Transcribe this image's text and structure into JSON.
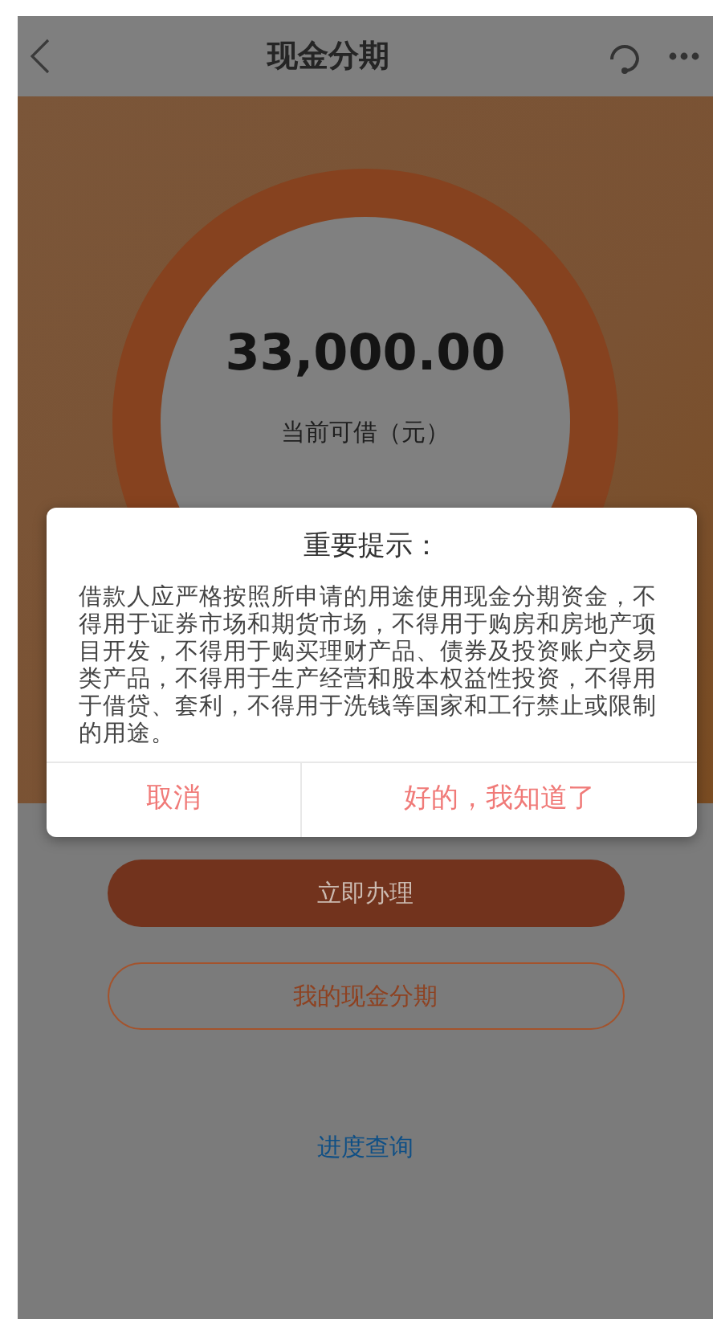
{
  "header": {
    "title": "现金分期"
  },
  "hero": {
    "amount": "33,000.00",
    "amount_label": "当前可借（元）"
  },
  "actions": [
    {
      "label": "立即办理",
      "kind": "primary"
    },
    {
      "label": "我的现金分期",
      "kind": "outline"
    }
  ],
  "progress_link": "进度查询",
  "dialog": {
    "title": "重要提示：",
    "message": "借款人应严格按照所申请的用途使用现金分期资金，不得用于证券市场和期货市场，不得用于购房和房地产项目开发，不得用于购买理财产品、债券及投资账户交易类产品，不得用于生产经营和股本权益性投资，不得用于借贷、套利，不得用于洗钱等国家和工行禁止或限制的用途。",
    "buttons": [
      {
        "label": "取消"
      },
      {
        "label": "好的，我知道了"
      }
    ]
  }
}
